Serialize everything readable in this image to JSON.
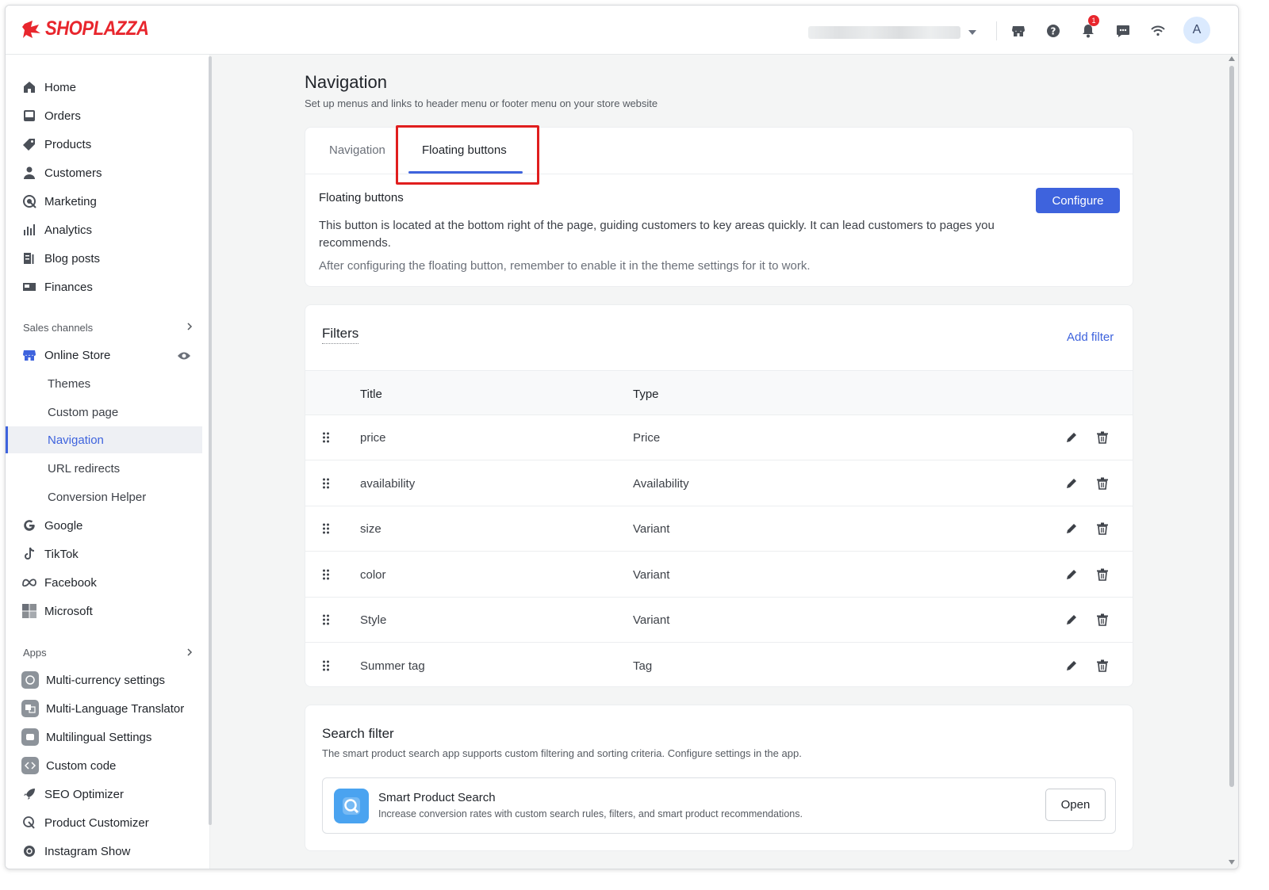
{
  "brand": {
    "name": "SHOPLAZZA",
    "color": "#e8262d"
  },
  "accent_color": "#3e63dd",
  "topbar": {
    "notification_count": "1",
    "avatar_initial": "A",
    "icons": [
      "store-icon",
      "help-icon",
      "bell-icon",
      "chat-icon",
      "wifi-icon"
    ]
  },
  "sidebar": {
    "items": [
      {
        "label": "Home",
        "icon": "home-icon"
      },
      {
        "label": "Orders",
        "icon": "orders-icon"
      },
      {
        "label": "Products",
        "icon": "tag-icon"
      },
      {
        "label": "Customers",
        "icon": "person-icon"
      },
      {
        "label": "Marketing",
        "icon": "marketing-icon"
      },
      {
        "label": "Analytics",
        "icon": "bar-chart-icon"
      },
      {
        "label": "Blog posts",
        "icon": "blog-icon"
      },
      {
        "label": "Finances",
        "icon": "finance-icon"
      }
    ],
    "sales_channels_label": "Sales channels",
    "online_store": "Online Store",
    "online_store_sub": [
      {
        "label": "Themes",
        "active": false
      },
      {
        "label": "Custom page",
        "active": false
      },
      {
        "label": "Navigation",
        "active": true
      },
      {
        "label": "URL redirects",
        "active": false
      },
      {
        "label": "Conversion Helper",
        "active": false
      }
    ],
    "channels": [
      {
        "label": "Google",
        "icon": "google-icon"
      },
      {
        "label": "TikTok",
        "icon": "tiktok-icon"
      },
      {
        "label": "Facebook",
        "icon": "meta-icon"
      },
      {
        "label": "Microsoft",
        "icon": "microsoft-icon"
      }
    ],
    "apps_label": "Apps",
    "apps": [
      {
        "label": "Multi-currency settings",
        "icon": "currency-app-icon"
      },
      {
        "label": "Multi-Language Translator",
        "icon": "translator-app-icon"
      },
      {
        "label": "Multilingual Settings",
        "icon": "multilingual-app-icon"
      },
      {
        "label": "Custom code",
        "icon": "code-app-icon"
      },
      {
        "label": "SEO Optimizer",
        "icon": "rocket-icon"
      },
      {
        "label": "Product Customizer",
        "icon": "customizer-icon"
      },
      {
        "label": "Instagram Show",
        "icon": "instagram-icon"
      }
    ]
  },
  "main": {
    "title": "Navigation",
    "subtitle": "Set up menus and links to header menu or footer menu on your store website",
    "tabs": [
      {
        "label": "Navigation",
        "active": false
      },
      {
        "label": "Floating buttons",
        "active": true
      }
    ],
    "floating": {
      "title": "Floating buttons",
      "description": "This button is located at the bottom right of the page, guiding customers to key areas quickly. It can lead customers to pages you recommends.",
      "note": "After configuring the floating button, remember to enable it in the theme settings for it to work.",
      "configure_label": "Configure"
    },
    "filters": {
      "title": "Filters",
      "add_label": "Add filter",
      "columns": [
        "Title",
        "Type"
      ],
      "rows": [
        {
          "title": "price",
          "type": "Price"
        },
        {
          "title": "availability",
          "type": "Availability"
        },
        {
          "title": "size",
          "type": "Variant"
        },
        {
          "title": "color",
          "type": "Variant"
        },
        {
          "title": "Style",
          "type": "Variant"
        },
        {
          "title": "Summer tag",
          "type": "Tag"
        }
      ]
    },
    "search_filter": {
      "title": "Search filter",
      "subtitle": "The smart product search app supports custom filtering and sorting criteria. Configure settings in the app.",
      "app_name": "Smart Product Search",
      "app_desc": "Increase conversion rates with custom search rules, filters, and smart product recommendations.",
      "open_label": "Open"
    }
  }
}
